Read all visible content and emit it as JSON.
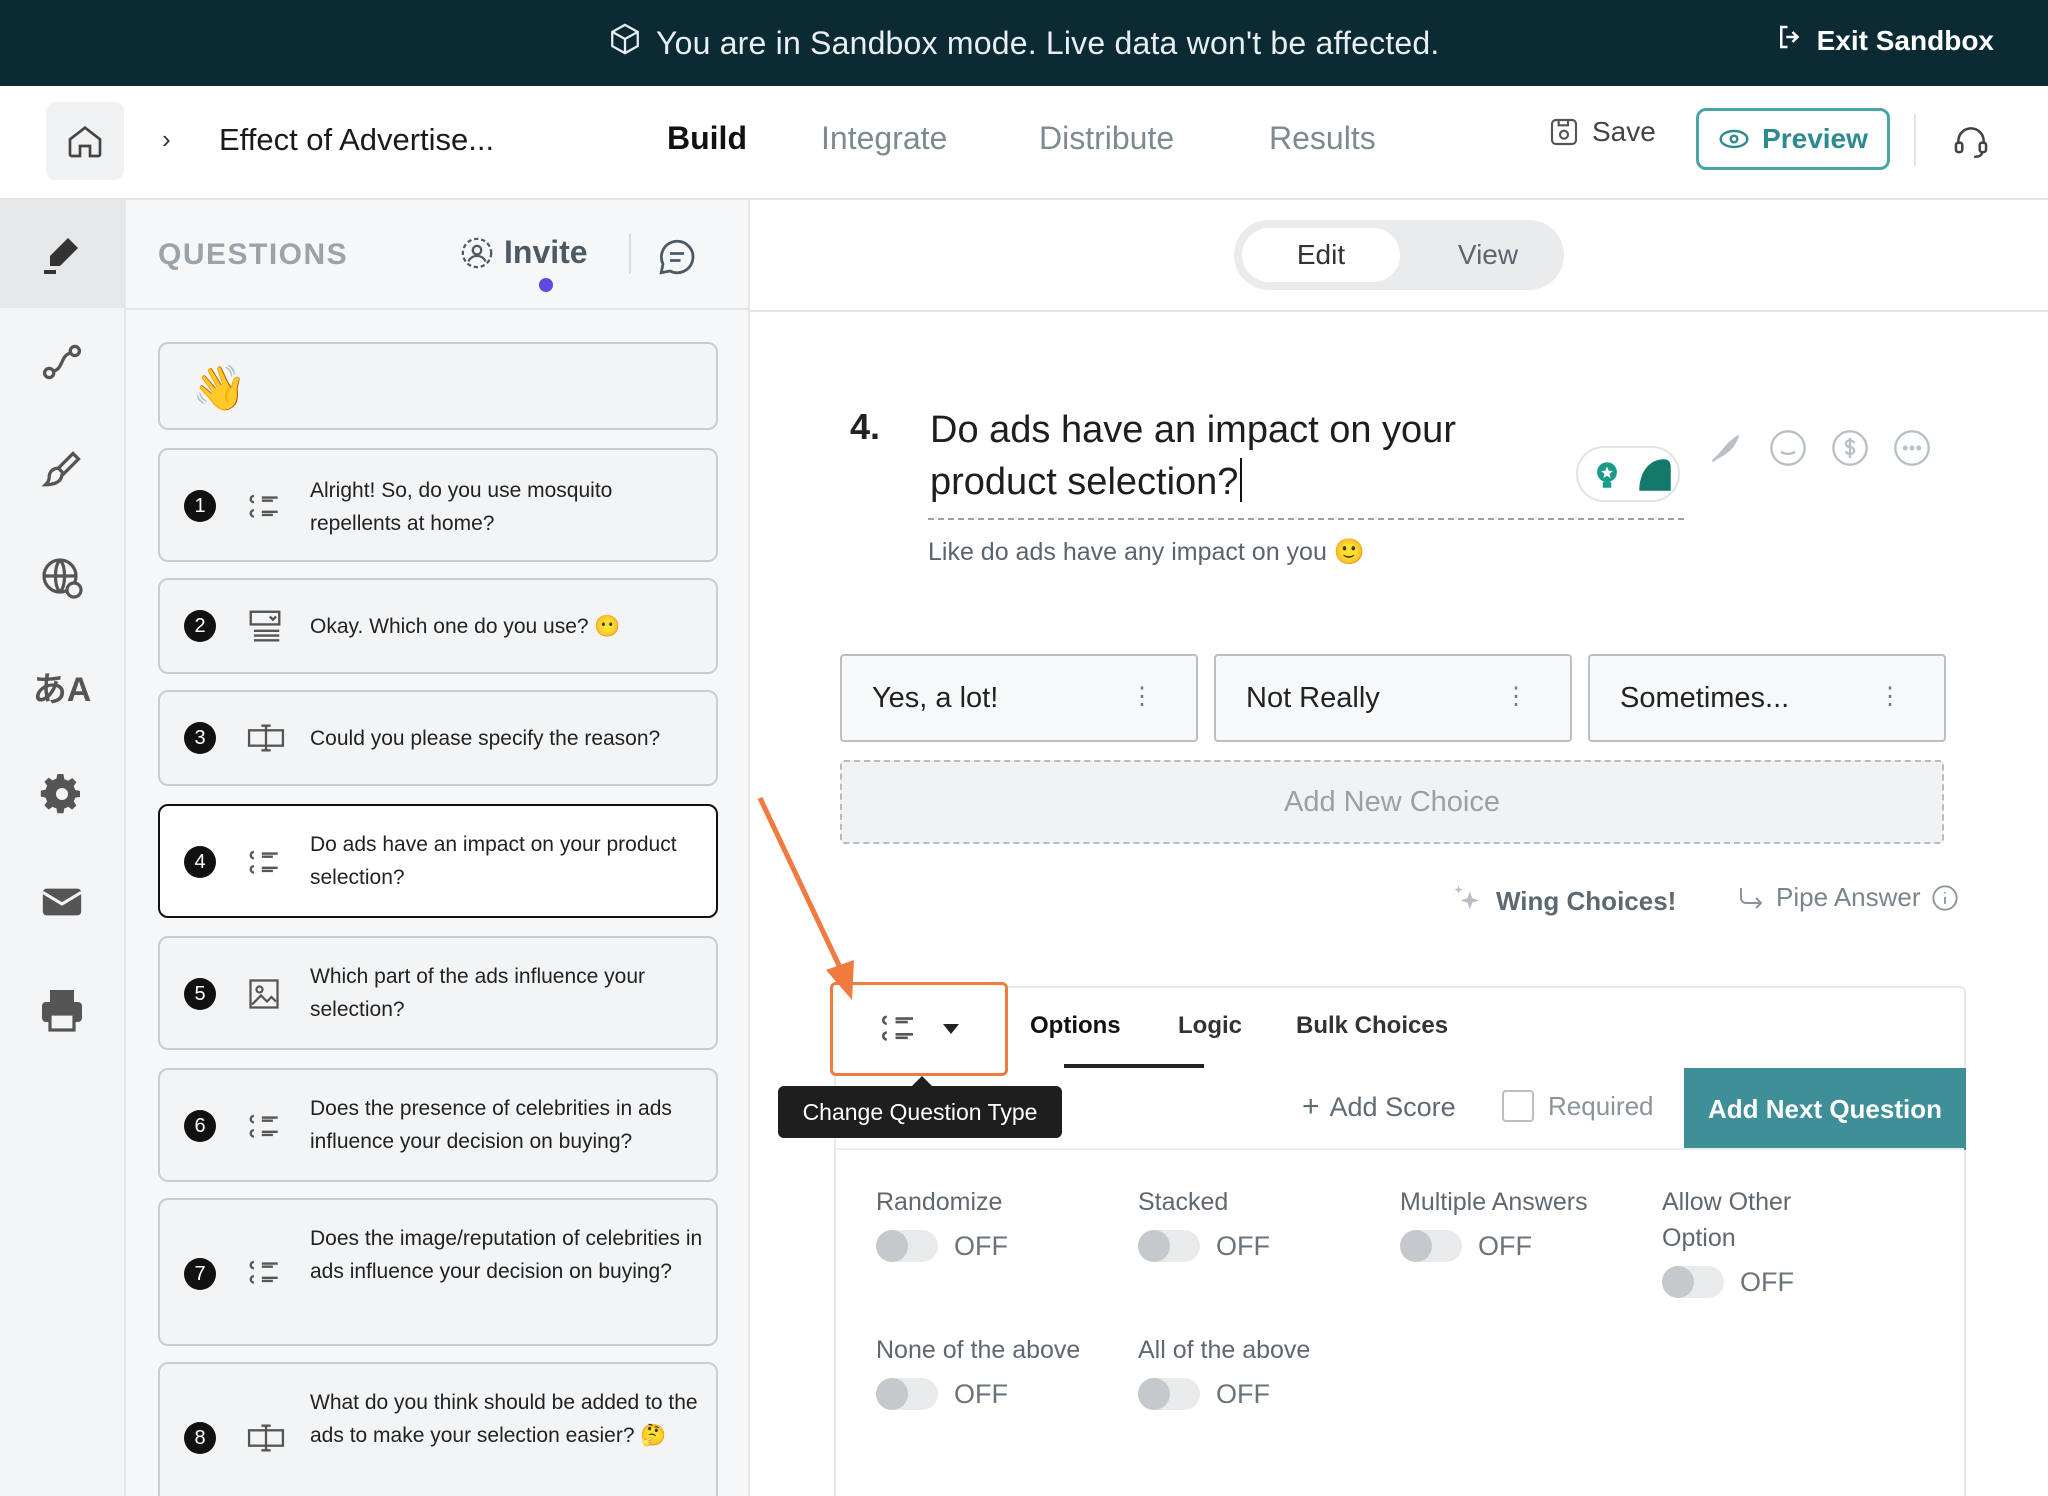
{
  "banner": {
    "message": "You are in Sandbox mode. Live data won't be affected.",
    "exit_label": "Exit Sandbox"
  },
  "header": {
    "survey_title": "Effect of Advertise...",
    "tabs": [
      "Build",
      "Integrate",
      "Distribute",
      "Results"
    ],
    "active_tab": "Build",
    "save_label": "Save",
    "preview_label": "Preview"
  },
  "panel": {
    "title": "QUESTIONS",
    "invite_label": "Invite"
  },
  "questions": [
    {
      "num": "1",
      "text": "Alright! So, do you use mosquito repellents at home?",
      "icon": "multiple-choice-icon"
    },
    {
      "num": "2",
      "text": "Okay. Which one do you use? 😶",
      "icon": "dropdown-icon"
    },
    {
      "num": "3",
      "text": "Could you please specify the reason?",
      "icon": "text-input-icon"
    },
    {
      "num": "4",
      "text": "Do ads have an impact on your product selection?",
      "icon": "multiple-choice-icon"
    },
    {
      "num": "5",
      "text": "Which part of the ads influence your selection?",
      "icon": "image-choice-icon"
    },
    {
      "num": "6",
      "text": "Does the presence of celebrities in ads influence your decision on buying?",
      "icon": "multiple-choice-icon"
    },
    {
      "num": "7",
      "text": "Does the image/reputation of celebrities in ads influence your decision on buying?",
      "icon": "multiple-choice-icon"
    },
    {
      "num": "8",
      "text": "What do you think should be added to the ads to make your selection easier? 🤔",
      "icon": "text-input-icon"
    }
  ],
  "editor": {
    "mode_edit": "Edit",
    "mode_view": "View",
    "question_number": "4.",
    "question_title": "Do ads have an impact on your product selection?",
    "question_description": "Like do ads have any impact on you 🙂",
    "choices": [
      "Yes, a lot!",
      "Not Really",
      "Sometimes..."
    ],
    "add_choice_label": "Add New Choice",
    "wing_choices_label": "Wing Choices!",
    "pipe_answer_label": "Pipe Answer"
  },
  "settings": {
    "tabs": [
      "Options",
      "Logic",
      "Bulk Choices"
    ],
    "tooltip": "Change Question Type",
    "add_score_label": "Add Score",
    "required_label": "Required",
    "add_next_label": "Add Next Question",
    "options": [
      {
        "label": "Randomize",
        "state": "OFF"
      },
      {
        "label": "Stacked",
        "state": "OFF"
      },
      {
        "label": "Multiple Answers",
        "state": "OFF"
      },
      {
        "label": "Allow Other Option",
        "state": "OFF"
      },
      {
        "label": "None of the above",
        "state": "OFF"
      },
      {
        "label": "All of the above",
        "state": "OFF"
      }
    ]
  },
  "colors": {
    "banner_bg": "#0b2a33",
    "accent_teal": "#3f8f98",
    "annotation_orange": "#f07a3f",
    "invite_dot": "#5b4be0"
  }
}
